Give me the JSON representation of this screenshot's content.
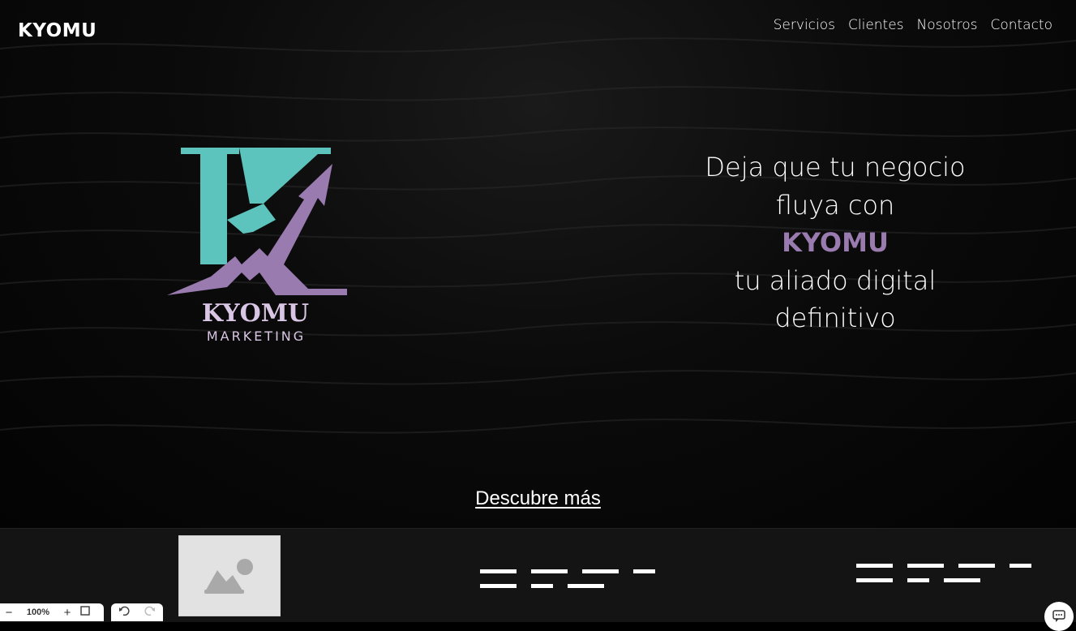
{
  "header": {
    "brand": "KYOMU",
    "nav": [
      {
        "label": "Servicios"
      },
      {
        "label": "Clientes"
      },
      {
        "label": "Nosotros"
      },
      {
        "label": "Contacto"
      }
    ]
  },
  "logo": {
    "name": "KYOMU",
    "subtitle": "MARKETING",
    "colors": {
      "teal": "#5cc4bc",
      "purple": "#9a7bb0",
      "text": "#d8c6e4"
    }
  },
  "hero": {
    "line1": "Deja que tu negocio",
    "line2": "fluya con",
    "brand": "KYOMU",
    "line3": "tu aliado digital",
    "line4": "definitivo",
    "cta": "Descubre más"
  },
  "editor": {
    "zoom": "100%",
    "zoom_out": "−",
    "zoom_in": "+"
  },
  "colors": {
    "accent": "#9a7bb0",
    "teal": "#5cc4bc",
    "strip": "#141414"
  }
}
